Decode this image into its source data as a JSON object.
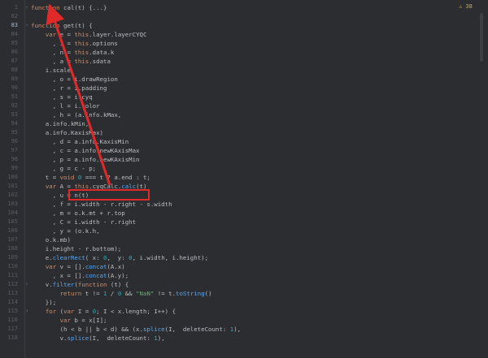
{
  "editor": {
    "warning_count": "⚠ 38",
    "lines": [
      {
        "n": "1",
        "text": "function cal(t) {...}"
      },
      {
        "n": "82",
        "text": ""
      },
      {
        "n": "83",
        "text": "function get(t) {"
      },
      {
        "n": "84",
        "text": "    var e = this.layer.layerCYQC"
      },
      {
        "n": "85",
        "text": "      , i = this.options"
      },
      {
        "n": "86",
        "text": "      , n = this.data.k"
      },
      {
        "n": "87",
        "text": "      , a = this.sdata"
      },
      {
        "n": "88",
        "text": "    i.scale"
      },
      {
        "n": "89",
        "text": "      , o = i.drawRegion"
      },
      {
        "n": "90",
        "text": "      , r = i.padding"
      },
      {
        "n": "91",
        "text": "      , s = i.cyq"
      },
      {
        "n": "92",
        "text": "      , l = i.color"
      },
      {
        "n": "93",
        "text": "      , h = (a.info.kMax,"
      },
      {
        "n": "94",
        "text": "    a.info.kMin,"
      },
      {
        "n": "95",
        "text": "    a.info.KaxisMax)"
      },
      {
        "n": "96",
        "text": "      , d = a.info.KaxisMin"
      },
      {
        "n": "97",
        "text": "      , c = a.info.newKAxisMax"
      },
      {
        "n": "98",
        "text": "      , p = a.info.newKAxisMin"
      },
      {
        "n": "99",
        "text": "      , g = c - p;"
      },
      {
        "n": "100",
        "text": "    t = void 0 === t ? a.end : t;"
      },
      {
        "n": "101",
        "text": "    var A = this.cyqCalc.calc(t)"
      },
      {
        "n": "102",
        "text": "      , u = n(t)"
      },
      {
        "n": "103",
        "text": "      , f = i.width - r.right - s.width"
      },
      {
        "n": "104",
        "text": "      , m = o.k.mt + r.top"
      },
      {
        "n": "105",
        "text": "      , C = i.width - r.right"
      },
      {
        "n": "106",
        "text": "      , y = (o.k.h,"
      },
      {
        "n": "107",
        "text": "    o.k.mb)"
      },
      {
        "n": "108",
        "text": "    i.height - r.bottom);"
      },
      {
        "n": "109",
        "text": "    e.clearRect( x: 0,  y: 0, i.width, i.height);"
      },
      {
        "n": "110",
        "text": "    var v = [].concat(A.x)"
      },
      {
        "n": "111",
        "text": "      , x = [].concat(A.y);"
      },
      {
        "n": "112",
        "text": "    v.filter(function (t) {"
      },
      {
        "n": "113",
        "text": "        return t != 1 / 0 && \"NaN\" != t.toString()"
      },
      {
        "n": "114",
        "text": "    });"
      },
      {
        "n": "115",
        "text": "    for (var I = 0; I < x.length; I++) {"
      },
      {
        "n": "116",
        "text": "        var b = x[I];"
      },
      {
        "n": "117",
        "text": "        (h < b || b < d) && (x.splice(I,  deleteCount: 1),"
      },
      {
        "n": "118",
        "text": "        v.splice(I,  deleteCount: 1),"
      }
    ]
  },
  "colors": {
    "background": "#2b2d30",
    "keyword": "#cf8e6d",
    "function": "#56a8f5",
    "property": "#c77dbb",
    "string": "#6aab73",
    "number": "#2aacb8",
    "annotation_box": "#e02a2a",
    "arrow": "#e02a2a"
  }
}
